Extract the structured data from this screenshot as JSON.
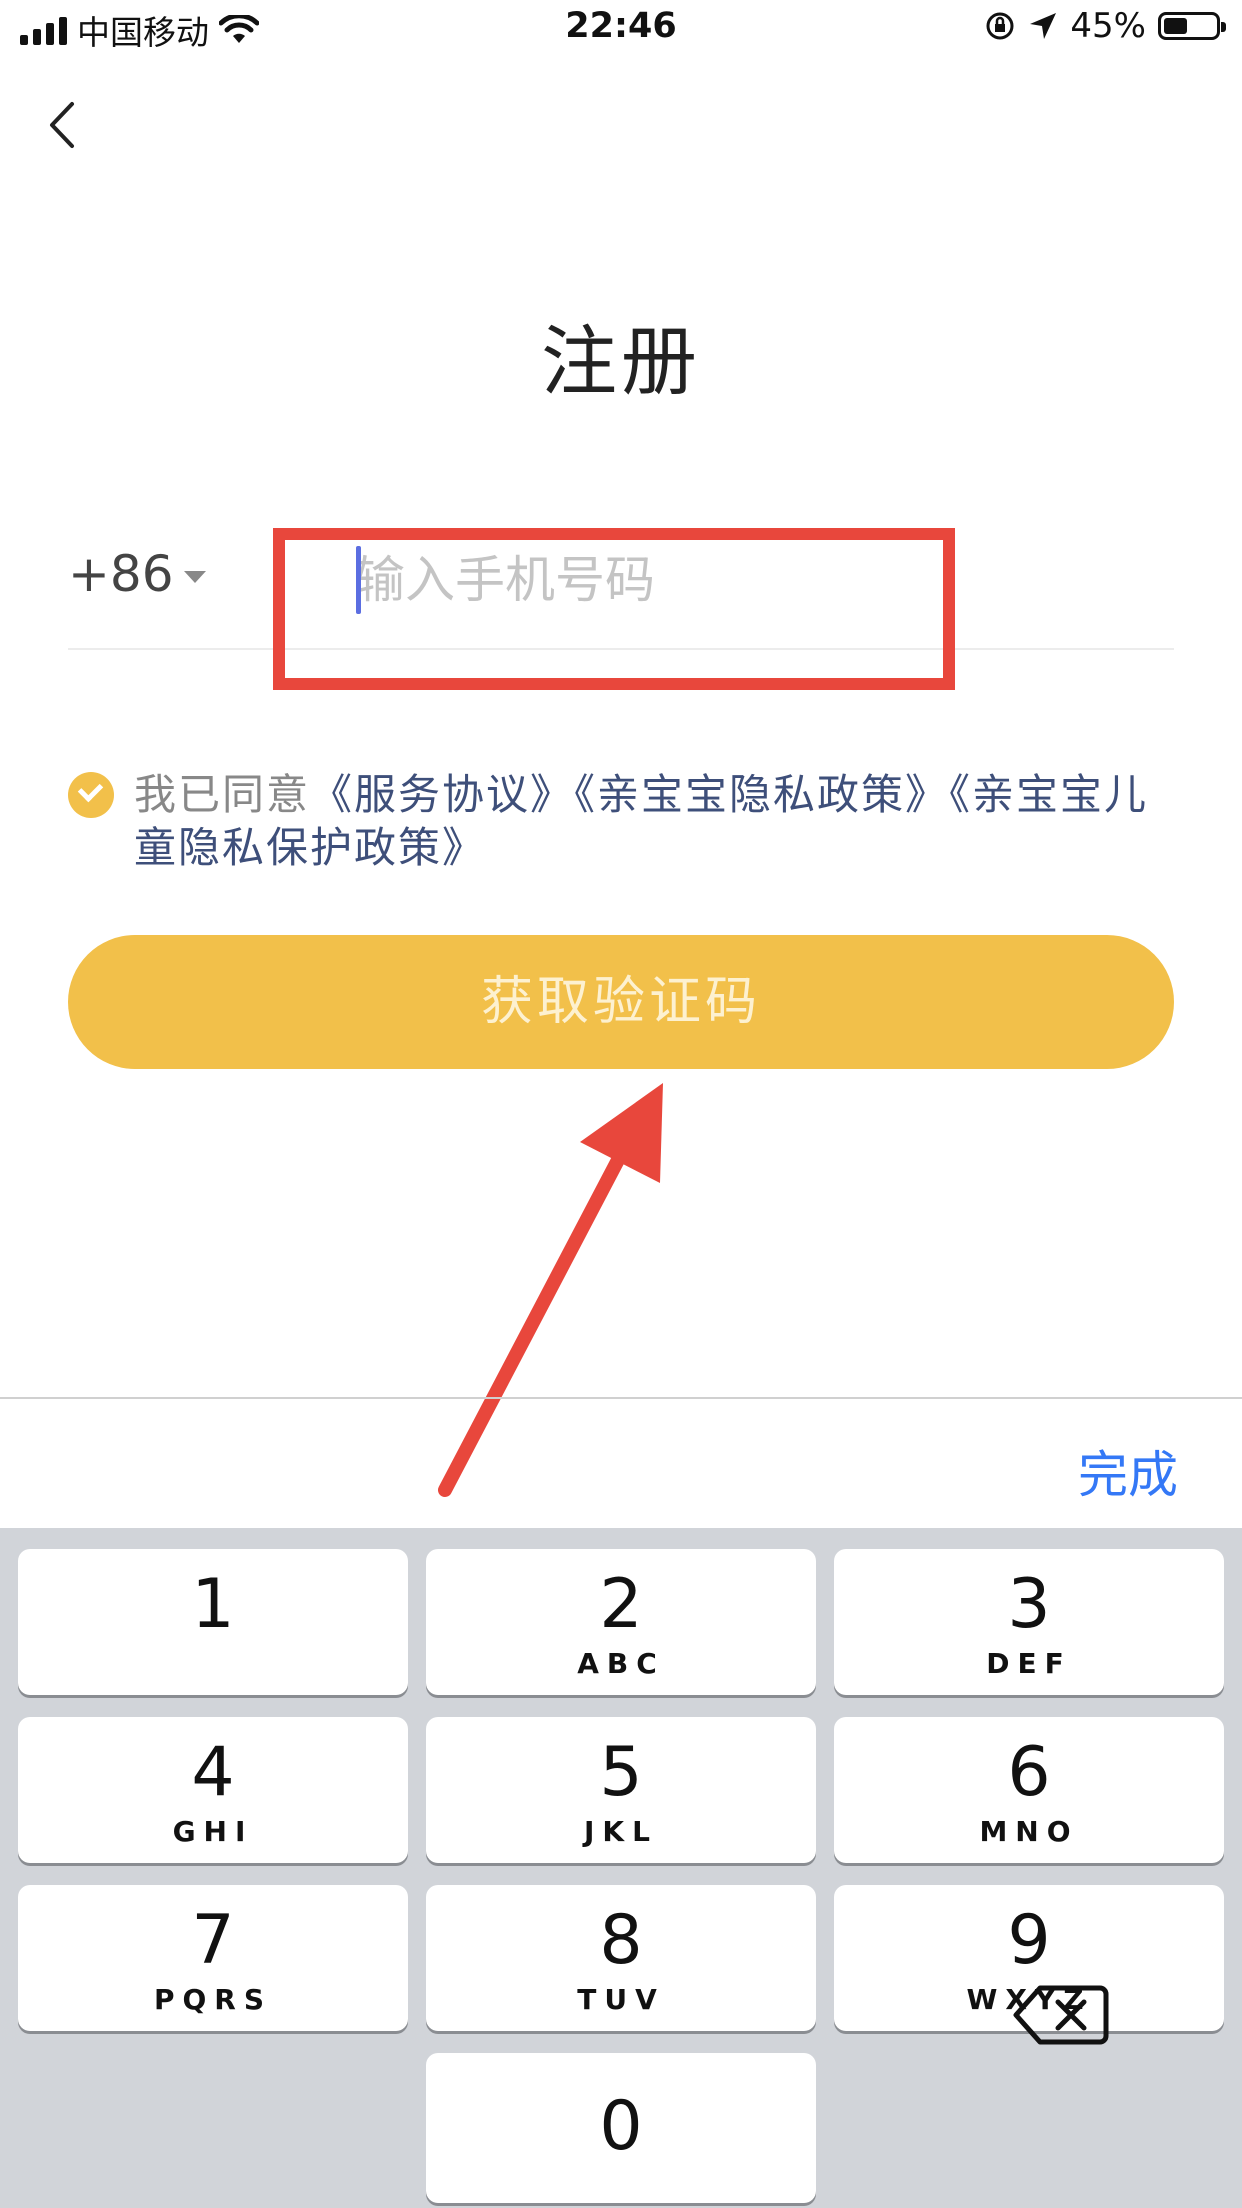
{
  "status_bar": {
    "carrier": "中国移动",
    "time": "22:46",
    "battery_percent": "45%",
    "battery_level": 0.45
  },
  "page": {
    "title": "注册"
  },
  "phone": {
    "country_code": "+86",
    "placeholder": "输入手机号码"
  },
  "agreement": {
    "prefix": "我已同意",
    "link_service": "《服务协议》",
    "link_privacy": "《亲宝宝隐私政策》",
    "link_child": "《亲宝宝儿童隐私保护政策》",
    "checked": true
  },
  "button": {
    "get_code": "获取验证码"
  },
  "keyboard": {
    "done_label": "完成",
    "keys": [
      {
        "num": "1",
        "letters": ""
      },
      {
        "num": "2",
        "letters": "ABC"
      },
      {
        "num": "3",
        "letters": "DEF"
      },
      {
        "num": "4",
        "letters": "GHI"
      },
      {
        "num": "5",
        "letters": "JKL"
      },
      {
        "num": "6",
        "letters": "MNO"
      },
      {
        "num": "7",
        "letters": "PQRS"
      },
      {
        "num": "8",
        "letters": "TUV"
      },
      {
        "num": "9",
        "letters": "WXYZ"
      },
      {
        "num": "0",
        "letters": ""
      }
    ]
  },
  "colors": {
    "accent_yellow": "#f2c04a",
    "annotation_red": "#e8473c",
    "keyboard_done_blue": "#3478f6",
    "link_color": "#3e4f7a"
  }
}
